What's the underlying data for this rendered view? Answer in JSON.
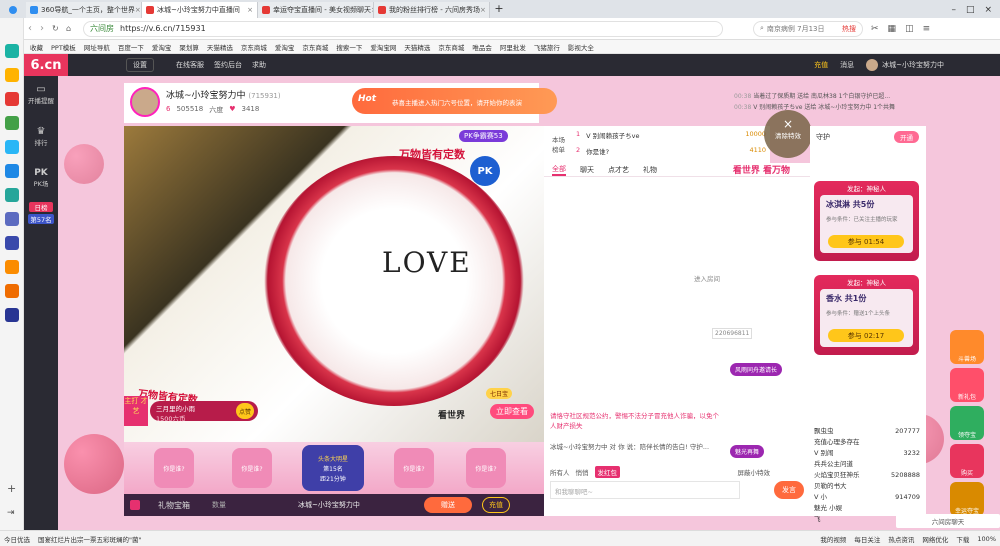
{
  "browser": {
    "tabs": [
      {
        "label": "360导航_一个主页，整个世界",
        "active": false
      },
      {
        "label": "冰城~小玲宝努力中直播间",
        "active": true
      },
      {
        "label": "幸运夺宝直播间 - 美女视频聊天",
        "active": false
      },
      {
        "label": "我的粉丝排行榜 - 六间房秀场",
        "active": false
      }
    ],
    "new_tab": "+",
    "url": "https://v.6.cn/715931",
    "site_label": "六间房",
    "search_placeholder": "南京病例 7月13日",
    "search_badge": "热搜",
    "bookmarks": [
      "收藏",
      "PPT模板",
      "网址导航",
      "百度一下",
      "爱淘宝",
      "聚划算",
      "天猫精选",
      "京东商城",
      "爱淘宝",
      "京东商城",
      "搜索一下",
      "爱淘宝网",
      "天猫精选",
      "京东商城",
      "唯品会",
      "阿里批发",
      "飞猪旅行",
      "影视大全"
    ]
  },
  "site": {
    "logo": "6.cn",
    "logo_sub": "六间房",
    "topnav": [
      "设置",
      "在线客服",
      "签约后台",
      "求助"
    ],
    "topright": [
      "充值",
      "消息"
    ],
    "user_name": "冰城~小玲宝努力中",
    "leftnav": [
      {
        "label": "开播提醒",
        "icon": "tv-icon"
      },
      {
        "label": "排行",
        "icon": "crown-icon"
      },
      {
        "label": "PK场",
        "icon": "pk-icon"
      },
      {
        "label": "日榜",
        "icon": "calendar-icon"
      },
      {
        "label": "第57名",
        "icon": ""
      }
    ],
    "host": {
      "name": "冰城~小玲宝努力中",
      "room_id": "(715931)",
      "level": "6",
      "fans": "505518",
      "fans_label": "六度",
      "score": "3418"
    },
    "banner_text": "恭喜主播进入热门六号位置，请开始你的表演",
    "banner_tag": "Hot",
    "system_msgs": [
      {
        "time": "00:38",
        "text": "当着过了保质期 送给 南瓜林38 1个白银守护已超..."
      },
      {
        "time": "00:38",
        "text": "V 别闹赖孩子ちve 送给 冰城~小玲宝努力中 1个共舞"
      }
    ],
    "video": {
      "pk_badge": "PK争霸赛53",
      "overlay_text": "万物皆有定数",
      "love_text": "LOVE",
      "seven_label": "七日宝",
      "watch_btn": "立即查看",
      "world_text": "看世界",
      "slogan": "看世界 看万物",
      "side_label": "主打 才艺",
      "prize_text": "三月里的小雨",
      "prize_sub": "1500六币",
      "prize_btn": "点赞"
    },
    "giftbar": {
      "slots": [
        "你是谁?",
        "你是谁?",
        "头条大明星",
        "你是谁?",
        "你是谁?"
      ],
      "star_rank": "第15名",
      "star_time": "距21分钟"
    },
    "inputbar": {
      "gift_label": "礼物宝箱",
      "qty_placeholder": "数量",
      "recipient": "冰城~小玲宝努力中",
      "send": "赠送",
      "recharge": "充值"
    },
    "rank_list": {
      "title": "本场榜单",
      "rows": [
        {
          "pos": "1",
          "name": "V 别闹赖孩子ちve",
          "score": "10000"
        },
        {
          "pos": "2",
          "name": "你是谁?",
          "score": "4110"
        }
      ]
    },
    "chat": {
      "tabs": [
        "全部",
        "聊天",
        "点才艺",
        "礼物"
      ],
      "active_tab": "全部",
      "messages": [
        "进入房间",
        "请恪守社区规范公约，警惕不法分子冒充他人诈骗，以免个人财产损失",
        "冰城~小玲宝努力中 对 你 说：陪伴长情的告白! 守护..."
      ],
      "effects": [
        "风雨同舟邀请长",
        "魅光再舞"
      ],
      "user_id": "220696811",
      "audience_label": "所有人",
      "whisper": "悄悄",
      "shield_label": "屏蔽小特效",
      "chat_placeholder": "和我聊聊吧~",
      "send": "发言",
      "red_pack": "发红包",
      "fortune": "大吉大利"
    },
    "guard": {
      "title": "守护",
      "open_btn": "开通",
      "close_label": "清除特效",
      "cards": [
        {
          "header": "发起：神秘人",
          "prize": "冰淇淋 共5份",
          "note": "参与条件：已关注主播的玩家",
          "btn": "参与",
          "time": "01:54"
        },
        {
          "header": "发起：神秘人",
          "prize": "香水 共1份",
          "note": "参与条件：赠送1个上头条",
          "btn": "参与",
          "time": "02:17"
        }
      ],
      "fans": [
        {
          "name": "飘虫虫",
          "score": "207777"
        },
        {
          "name": "充值心理多存在",
          "score": ""
        },
        {
          "name": "V 别闹",
          "score": "3232"
        },
        {
          "name": "兵兵公主问道",
          "score": ""
        },
        {
          "name": "火焰宝贝狂神乐",
          "score": "5208888"
        },
        {
          "name": "贝勒的书大",
          "score": ""
        },
        {
          "name": "V 小",
          "score": "914709"
        },
        {
          "name": "魅光 小娱",
          "score": ""
        },
        {
          "name": "飞",
          "score": "12123"
        }
      ]
    },
    "rightbar": [
      "斗兽场",
      "新礼包",
      "领夺宝",
      "购买",
      "幸运夺宝"
    ],
    "bottom_chat_label": "六间房聊天"
  },
  "statusbar": {
    "items": [
      "今日优选",
      "国宴红烂片出宗一票五彩斑斓的\"菌\"",
      "我的视频",
      "每日关注",
      "热点资讯",
      "网络优化",
      "下载",
      "100%"
    ]
  },
  "colors": {
    "accent": "#e6306f",
    "dark": "#2a2a33",
    "gold": "#ffc61a",
    "pink_bg": "#f5c6dc"
  }
}
